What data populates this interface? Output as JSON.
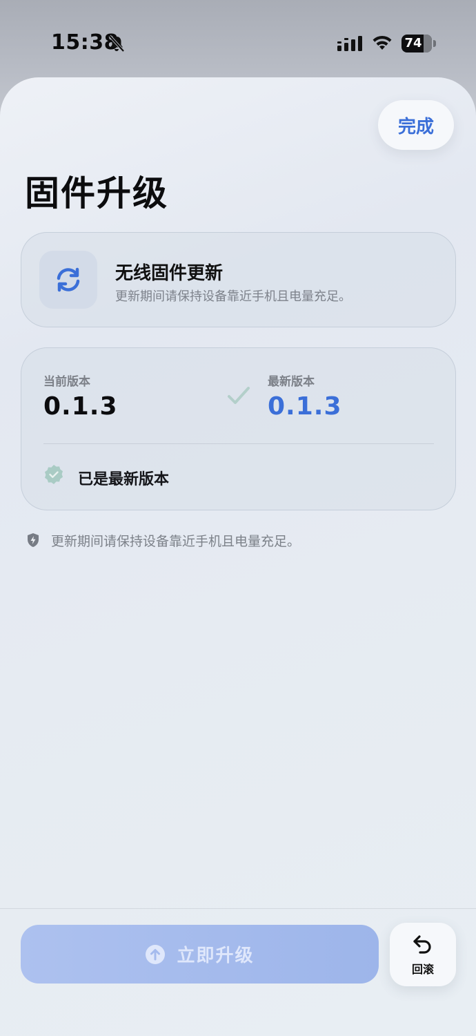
{
  "status_bar": {
    "time": "15:38",
    "battery_level": "74",
    "icons": [
      "bell-slash-icon",
      "cellular-signal-icon",
      "wifi-icon",
      "battery-icon"
    ]
  },
  "header": {
    "done_label": "完成",
    "title": "固件升级"
  },
  "ota_card": {
    "icon": "refresh-icon",
    "title": "无线固件更新",
    "subtitle": "更新期间请保持设备靠近手机且电量充足。"
  },
  "version_card": {
    "current_label": "当前版本",
    "current_value": "0.1.3",
    "latest_label": "最新版本",
    "latest_value": "0.1.3",
    "status_text": "已是最新版本"
  },
  "note": {
    "icon": "shield-bolt-icon",
    "text": "更新期间请保持设备靠近手机且电量充足。"
  },
  "footer": {
    "upgrade_label": "立即升级",
    "rollback_label": "回滚"
  },
  "colors": {
    "accent": "#3b6fd8",
    "upgrade_button_disabled": "#a6bcee",
    "success_check": "#a9cbc4"
  }
}
